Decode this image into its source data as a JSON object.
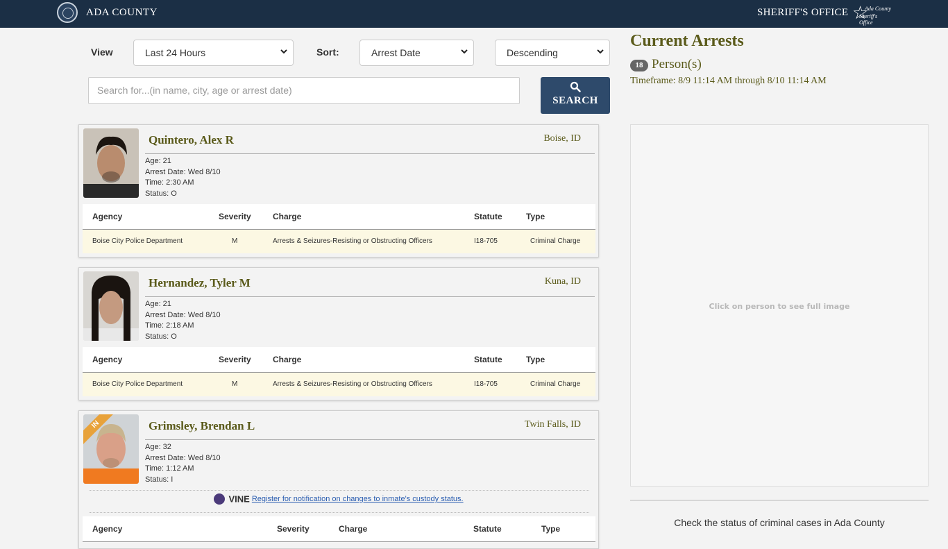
{
  "header": {
    "county": "ADA COUNTY",
    "office": "SHERIFF'S OFFICE",
    "logo_line1": "Ada County",
    "logo_line2": "Sheriff's Office"
  },
  "controls": {
    "view_label": "View",
    "view_value": "Last 24 Hours",
    "sort_label": "Sort:",
    "sort_value": "Arrest Date",
    "order_value": "Descending",
    "search_placeholder": "Search for...(in name, city, age or arrest date)",
    "search_button": "SEARCH"
  },
  "table_headers": {
    "agency": "Agency",
    "severity": "Severity",
    "charge": "Charge",
    "statute": "Statute",
    "type": "Type"
  },
  "people": [
    {
      "name": "Quintero, Alex R",
      "city": "Boise, ID",
      "age": "Age: 21",
      "arrest_date": "Arrest Date: Wed 8/10",
      "time": "Time: 2:30 AM",
      "status": "Status: O",
      "charges": [
        {
          "agency": "Boise City Police Department",
          "severity": "M",
          "charge": "Arrests & Seizures-Resisting or Obstructing Officers",
          "statute": "I18-705",
          "type": "Criminal Charge"
        }
      ]
    },
    {
      "name": "Hernandez, Tyler M",
      "city": "Kuna, ID",
      "age": "Age: 21",
      "arrest_date": "Arrest Date: Wed 8/10",
      "time": "Time: 2:18 AM",
      "status": "Status: O",
      "charges": [
        {
          "agency": "Boise City Police Department",
          "severity": "M",
          "charge": "Arrests & Seizures-Resisting or Obstructing Officers",
          "statute": "I18-705",
          "type": "Criminal Charge"
        }
      ]
    },
    {
      "name": "Grimsley, Brendan L",
      "city": "Twin Falls, ID",
      "age": "Age: 32",
      "arrest_date": "Arrest Date: Wed 8/10",
      "time": "Time: 1:12 AM",
      "status": "Status: I",
      "ribbon": "IN",
      "vine": {
        "word": "VINE",
        "link": " Register for notification on changes to inmate's custody status."
      }
    }
  ],
  "sidebar": {
    "title": "Current Arrests",
    "count": "18",
    "persons_label": "Person(s)",
    "timeframe": "Timeframe: 8/9 11:14 AM through 8/10 11:14 AM",
    "preview_msg": "Click on person to see full image",
    "footer": "Check the status of criminal cases in Ada County"
  },
  "colors": {
    "navbar": "#1b2f45",
    "accent": "#5a5a1a",
    "button": "#2e4a6b",
    "row_highlight": "#fcf8e3"
  }
}
